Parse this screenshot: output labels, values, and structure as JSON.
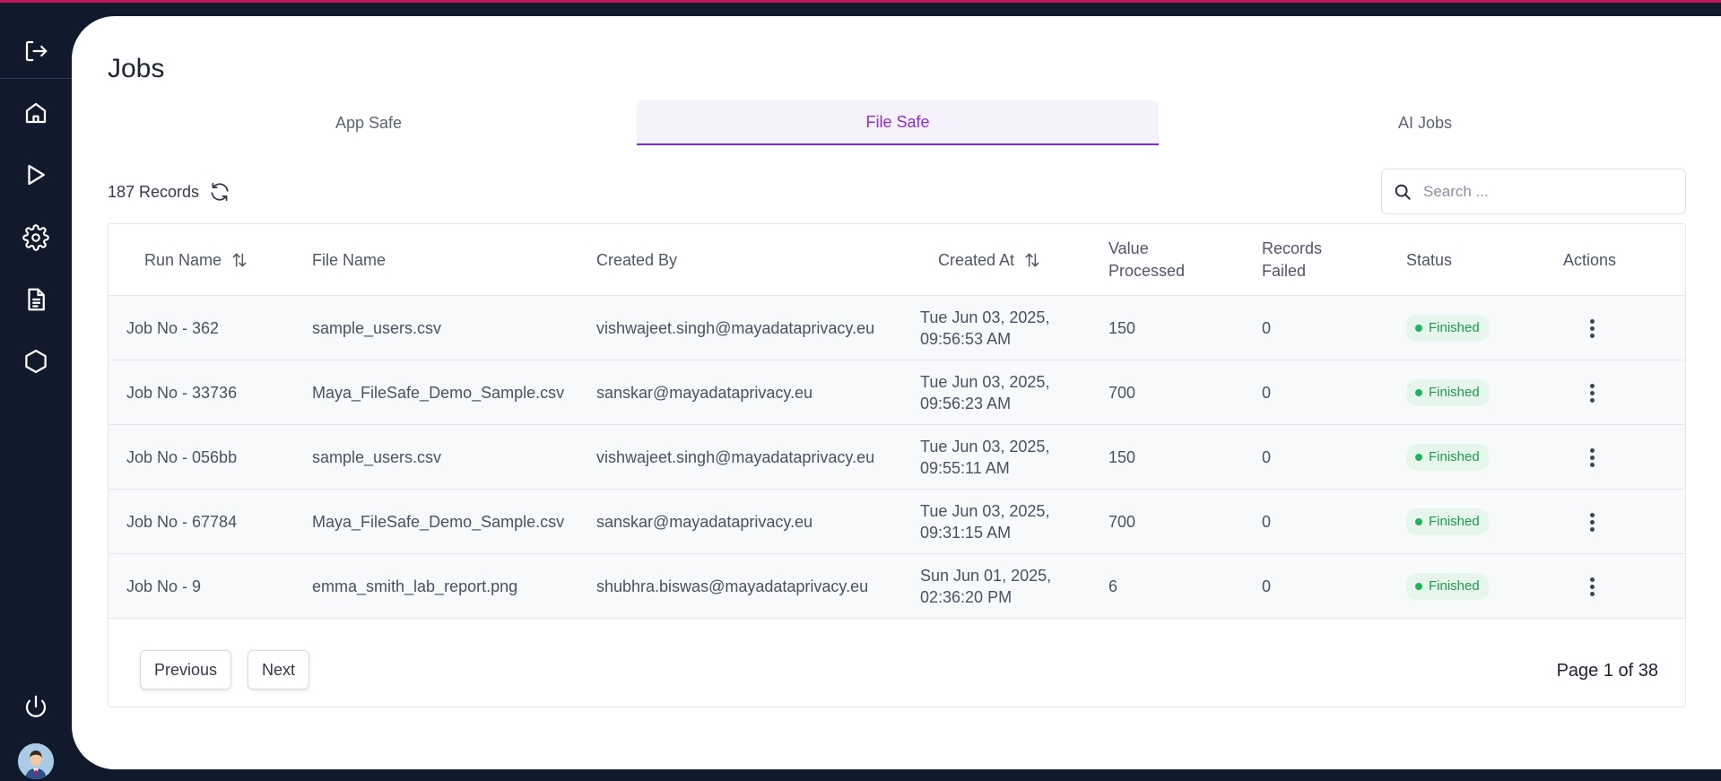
{
  "page": {
    "title": "Jobs"
  },
  "tabs": [
    {
      "label": "App Safe",
      "active": false
    },
    {
      "label": "File Safe",
      "active": true
    },
    {
      "label": "AI Jobs",
      "active": false
    }
  ],
  "toolbar": {
    "records": "187 Records",
    "search_placeholder": "Search ..."
  },
  "table": {
    "headers": {
      "run_name": "Run Name",
      "file_name": "File Name",
      "created_by": "Created By",
      "created_at": "Created At",
      "value_processed": "Value Processed",
      "records_failed": "Records Failed",
      "status": "Status",
      "actions": "Actions"
    },
    "rows": [
      {
        "run_name": "Job No - 362",
        "file_name": "sample_users.csv",
        "created_by": "vishwajeet.singh@mayadataprivacy.eu",
        "created_at": "Tue Jun 03, 2025, 09:56:53 AM",
        "value_processed": "150",
        "records_failed": "0",
        "status": "Finished"
      },
      {
        "run_name": "Job No - 33736",
        "file_name": "Maya_FileSafe_Demo_Sample.csv",
        "created_by": "sanskar@mayadataprivacy.eu",
        "created_at": "Tue Jun 03, 2025, 09:56:23 AM",
        "value_processed": "700",
        "records_failed": "0",
        "status": "Finished"
      },
      {
        "run_name": "Job No - 056bb",
        "file_name": "sample_users.csv",
        "created_by": "vishwajeet.singh@mayadataprivacy.eu",
        "created_at": "Tue Jun 03, 2025, 09:55:11 AM",
        "value_processed": "150",
        "records_failed": "0",
        "status": "Finished"
      },
      {
        "run_name": "Job No - 67784",
        "file_name": "Maya_FileSafe_Demo_Sample.csv",
        "created_by": "sanskar@mayadataprivacy.eu",
        "created_at": "Tue Jun 03, 2025, 09:31:15 AM",
        "value_processed": "700",
        "records_failed": "0",
        "status": "Finished"
      },
      {
        "run_name": "Job No - 9",
        "file_name": "emma_smith_lab_report.png",
        "created_by": "shubhra.biswas@mayadataprivacy.eu",
        "created_at": "Sun Jun 01, 2025, 02:36:20 PM",
        "value_processed": "6",
        "records_failed": "0",
        "status": "Finished"
      }
    ]
  },
  "pagination": {
    "previous": "Previous",
    "next": "Next",
    "page_info": "Page 1 of 38"
  },
  "sidebar": {
    "icons": [
      "logout-icon",
      "home-icon",
      "play-icon",
      "gear-icon",
      "document-icon",
      "hexagon-icon",
      "power-icon"
    ]
  },
  "colors": {
    "accent": "#8b2fd1",
    "sidebar_bg": "#111a2c",
    "status_green": "#22b35a",
    "top_bar": "#c2185b"
  }
}
